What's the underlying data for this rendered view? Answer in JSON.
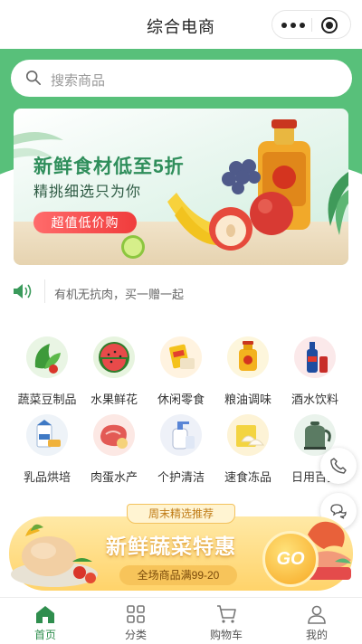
{
  "header": {
    "title": "综合电商",
    "more_icon": "more-dots-icon",
    "close_icon": "target-circle-icon"
  },
  "theme": {
    "primary": "#58c07a",
    "accent": "#f03c3c",
    "tab_active": "#2f8e4e"
  },
  "search": {
    "placeholder": "搜索商品",
    "icon": "search-icon"
  },
  "banner": {
    "title": "新鲜食材低至5折",
    "subtitle": "精挑细选只为你",
    "button_label": "超值低价购"
  },
  "notice": {
    "icon": "speaker-icon",
    "text": "有机无抗肉，买一赠一起"
  },
  "categories": [
    {
      "label": "蔬菜豆制品",
      "icon": "vegetable-icon"
    },
    {
      "label": "水果鲜花",
      "icon": "watermelon-icon"
    },
    {
      "label": "休闲零食",
      "icon": "snack-icon"
    },
    {
      "label": "粮油调味",
      "icon": "oil-bottle-icon"
    },
    {
      "label": "酒水饮料",
      "icon": "drink-bottle-icon"
    },
    {
      "label": "乳品烘培",
      "icon": "milk-icon"
    },
    {
      "label": "肉蛋水产",
      "icon": "meat-icon"
    },
    {
      "label": "个护清洁",
      "icon": "cleaning-bottle-icon"
    },
    {
      "label": "速食冻品",
      "icon": "dumpling-icon"
    },
    {
      "label": "日用百货",
      "icon": "kettle-icon"
    }
  ],
  "floating": {
    "phone_icon": "phone-icon",
    "chat_icon": "chat-icon"
  },
  "promo": {
    "tag": "周末精选推荐",
    "headline": "新鲜蔬菜特惠",
    "discount": "全场商品满99-20",
    "go_label": "GO"
  },
  "tabbar": [
    {
      "label": "首页",
      "icon": "home-icon",
      "active": true
    },
    {
      "label": "分类",
      "icon": "grid-icon",
      "active": false
    },
    {
      "label": "购物车",
      "icon": "cart-icon",
      "active": false
    },
    {
      "label": "我的",
      "icon": "user-icon",
      "active": false
    }
  ]
}
